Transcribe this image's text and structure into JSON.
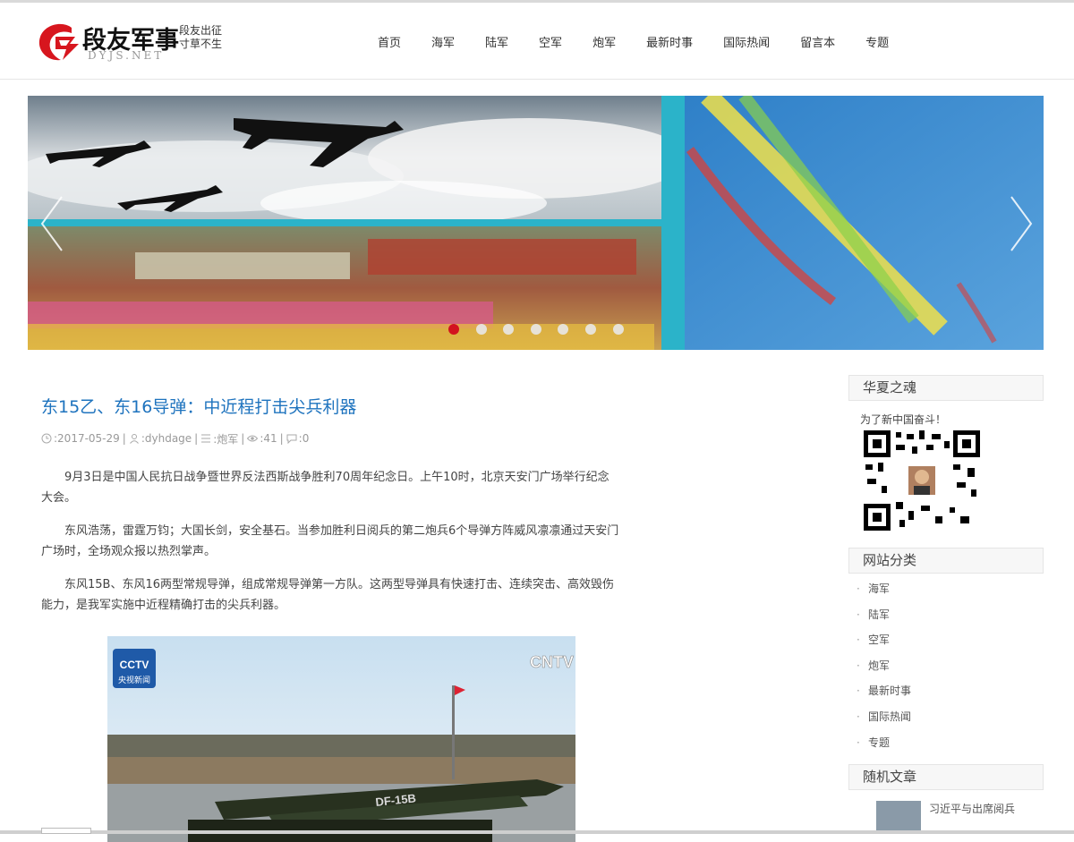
{
  "site": {
    "logo_title": "段友军事",
    "logo_domain": "DYJS.NET",
    "logo_slogan": "段友出征 寸草不生"
  },
  "nav": [
    "首页",
    "海军",
    "陆军",
    "空军",
    "炮军",
    "最新时事",
    "国际热闻",
    "留言本",
    "专题"
  ],
  "banner": {
    "slides_count": 7,
    "active_slide": 1
  },
  "article": {
    "title": "东15乙、东16导弹：中近程打击尖兵利器",
    "date": ":2017-05-29",
    "author": ":dyhdage",
    "category": ":炮军",
    "views": ":41",
    "comments": ":0",
    "paragraphs": [
      "9月3日是中国人民抗日战争暨世界反法西斯战争胜利70周年纪念日。上午10时，北京天安门广场举行纪念大会。",
      "东风浩荡，雷霆万钧；大国长剑，安全基石。当参加胜利日阅兵的第二炮兵6个导弹方阵威风凛凛通过天安门广场时，全场观众报以热烈掌声。",
      "东风15B、东风16两型常规导弹，组成常规导弹第一方队。这两型导弹具有快速打击、连续突击、高效毁伤能力，是我军实施中近程精确打击的尖兵利器。"
    ],
    "image_labels": {
      "cctv": "CCTV",
      "cctv_sub": "央视新闻",
      "cntv": "CNTV",
      "missile": "DF-15B"
    }
  },
  "sidebar": {
    "widget1_title": "华夏之魂",
    "widget1_text": "为了新中国奋斗！",
    "widget2_title": "网站分类",
    "categories": [
      "海军",
      "陆军",
      "空军",
      "炮军",
      "最新时事",
      "国际热闻",
      "专题"
    ],
    "widget3_title": "随机文章",
    "random_article": "习近平与出席阅兵"
  },
  "colors": {
    "link_blue": "#1e73be",
    "logo_red": "#d7161e",
    "dot_active": "#d0021b"
  }
}
